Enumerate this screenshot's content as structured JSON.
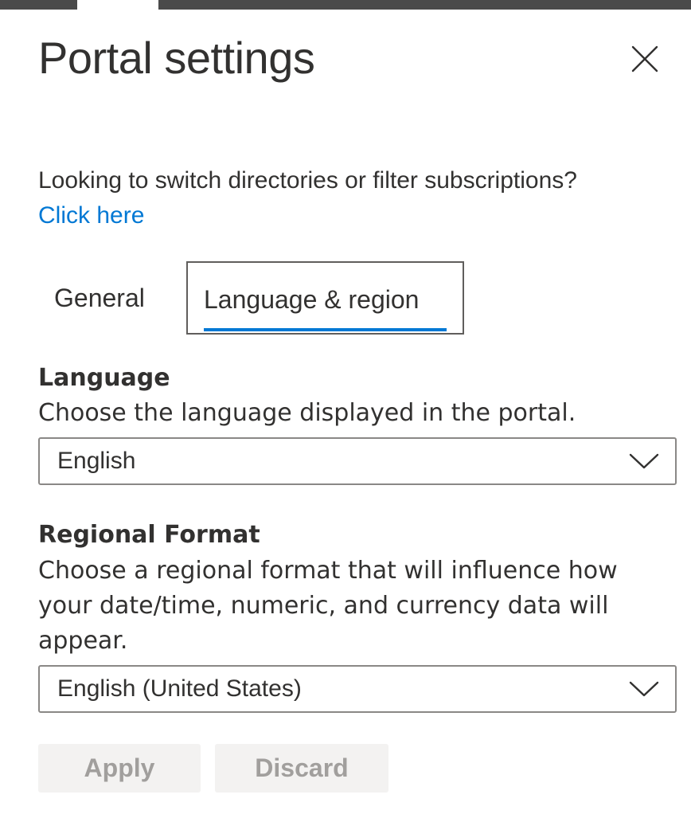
{
  "panel": {
    "title": "Portal settings",
    "close_label": "Close"
  },
  "helper": {
    "text": "Looking to switch directories or filter subscriptions?",
    "link": "Click here"
  },
  "tabs": [
    {
      "label": "General",
      "selected": false
    },
    {
      "label": "Language & region",
      "selected": true
    }
  ],
  "language": {
    "label": "Language",
    "description": "Choose the language displayed in the portal.",
    "selected": "English"
  },
  "regional_format": {
    "label": "Regional Format",
    "description": "Choose a regional format that will influence how your date/time, numeric, and currency data will appear.",
    "selected": "English (United States)"
  },
  "actions": {
    "apply": "Apply",
    "discard": "Discard"
  },
  "colors": {
    "accent": "#0078d4",
    "text": "#323130",
    "disabled_bg": "#f3f2f1",
    "disabled_text": "#a19f9d"
  },
  "icons": {
    "close": "close-icon",
    "dropdown": "chevron-down-icon"
  }
}
